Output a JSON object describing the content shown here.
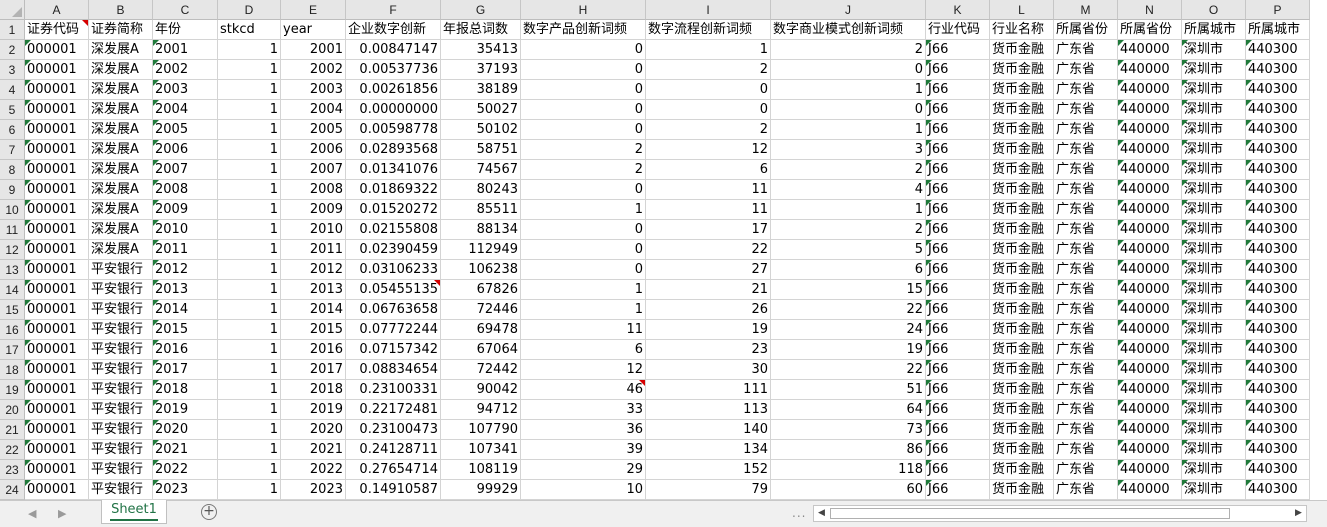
{
  "sheet_tabs": [
    "Sheet1"
  ],
  "add_sheet_symbol": "+",
  "nav": {
    "prev": "◀",
    "next": "▶",
    "more": "..."
  },
  "columns": [
    "A",
    "B",
    "C",
    "D",
    "E",
    "F",
    "G",
    "H",
    "I",
    "J",
    "K",
    "L",
    "M",
    "N",
    "O",
    "P"
  ],
  "headers": [
    "证券代码",
    "证券简称",
    "年份",
    "stkcd",
    "year",
    "企业数字创新",
    "年报总词数",
    "数字产品创新词频",
    "数字流程创新词频",
    "数字商业模式创新词频",
    "行业代码",
    "行业名称",
    "所属省份",
    "所属省份",
    "所属城市",
    "所属城市"
  ],
  "rows": [
    [
      "000001",
      "深发展A",
      "2001",
      "1",
      "2001",
      "0.00847147",
      "35413",
      "0",
      "1",
      "2",
      "J66",
      "货币金融",
      "广东省",
      "440000",
      "深圳市",
      "440300"
    ],
    [
      "000001",
      "深发展A",
      "2002",
      "1",
      "2002",
      "0.00537736",
      "37193",
      "0",
      "2",
      "0",
      "J66",
      "货币金融",
      "广东省",
      "440000",
      "深圳市",
      "440300"
    ],
    [
      "000001",
      "深发展A",
      "2003",
      "1",
      "2003",
      "0.00261856",
      "38189",
      "0",
      "0",
      "1",
      "J66",
      "货币金融",
      "广东省",
      "440000",
      "深圳市",
      "440300"
    ],
    [
      "000001",
      "深发展A",
      "2004",
      "1",
      "2004",
      "0.00000000",
      "50027",
      "0",
      "0",
      "0",
      "J66",
      "货币金融",
      "广东省",
      "440000",
      "深圳市",
      "440300"
    ],
    [
      "000001",
      "深发展A",
      "2005",
      "1",
      "2005",
      "0.00598778",
      "50102",
      "0",
      "2",
      "1",
      "J66",
      "货币金融",
      "广东省",
      "440000",
      "深圳市",
      "440300"
    ],
    [
      "000001",
      "深发展A",
      "2006",
      "1",
      "2006",
      "0.02893568",
      "58751",
      "2",
      "12",
      "3",
      "J66",
      "货币金融",
      "广东省",
      "440000",
      "深圳市",
      "440300"
    ],
    [
      "000001",
      "深发展A",
      "2007",
      "1",
      "2007",
      "0.01341076",
      "74567",
      "2",
      "6",
      "2",
      "J66",
      "货币金融",
      "广东省",
      "440000",
      "深圳市",
      "440300"
    ],
    [
      "000001",
      "深发展A",
      "2008",
      "1",
      "2008",
      "0.01869322",
      "80243",
      "0",
      "11",
      "4",
      "J66",
      "货币金融",
      "广东省",
      "440000",
      "深圳市",
      "440300"
    ],
    [
      "000001",
      "深发展A",
      "2009",
      "1",
      "2009",
      "0.01520272",
      "85511",
      "1",
      "11",
      "1",
      "J66",
      "货币金融",
      "广东省",
      "440000",
      "深圳市",
      "440300"
    ],
    [
      "000001",
      "深发展A",
      "2010",
      "1",
      "2010",
      "0.02155808",
      "88134",
      "0",
      "17",
      "2",
      "J66",
      "货币金融",
      "广东省",
      "440000",
      "深圳市",
      "440300"
    ],
    [
      "000001",
      "深发展A",
      "2011",
      "1",
      "2011",
      "0.02390459",
      "112949",
      "0",
      "22",
      "5",
      "J66",
      "货币金融",
      "广东省",
      "440000",
      "深圳市",
      "440300"
    ],
    [
      "000001",
      "平安银行",
      "2012",
      "1",
      "2012",
      "0.03106233",
      "106238",
      "0",
      "27",
      "6",
      "J66",
      "货币金融",
      "广东省",
      "440000",
      "深圳市",
      "440300"
    ],
    [
      "000001",
      "平安银行",
      "2013",
      "1",
      "2013",
      "0.05455135",
      "67826",
      "1",
      "21",
      "15",
      "J66",
      "货币金融",
      "广东省",
      "440000",
      "深圳市",
      "440300"
    ],
    [
      "000001",
      "平安银行",
      "2014",
      "1",
      "2014",
      "0.06763658",
      "72446",
      "1",
      "26",
      "22",
      "J66",
      "货币金融",
      "广东省",
      "440000",
      "深圳市",
      "440300"
    ],
    [
      "000001",
      "平安银行",
      "2015",
      "1",
      "2015",
      "0.07772244",
      "69478",
      "11",
      "19",
      "24",
      "J66",
      "货币金融",
      "广东省",
      "440000",
      "深圳市",
      "440300"
    ],
    [
      "000001",
      "平安银行",
      "2016",
      "1",
      "2016",
      "0.07157342",
      "67064",
      "6",
      "23",
      "19",
      "J66",
      "货币金融",
      "广东省",
      "440000",
      "深圳市",
      "440300"
    ],
    [
      "000001",
      "平安银行",
      "2017",
      "1",
      "2017",
      "0.08834654",
      "72442",
      "12",
      "30",
      "22",
      "J66",
      "货币金融",
      "广东省",
      "440000",
      "深圳市",
      "440300"
    ],
    [
      "000001",
      "平安银行",
      "2018",
      "1",
      "2018",
      "0.23100331",
      "90042",
      "46",
      "111",
      "51",
      "J66",
      "货币金融",
      "广东省",
      "440000",
      "深圳市",
      "440300"
    ],
    [
      "000001",
      "平安银行",
      "2019",
      "1",
      "2019",
      "0.22172481",
      "94712",
      "33",
      "113",
      "64",
      "J66",
      "货币金融",
      "广东省",
      "440000",
      "深圳市",
      "440300"
    ],
    [
      "000001",
      "平安银行",
      "2020",
      "1",
      "2020",
      "0.23100473",
      "107790",
      "36",
      "140",
      "73",
      "J66",
      "货币金融",
      "广东省",
      "440000",
      "深圳市",
      "440300"
    ],
    [
      "000001",
      "平安银行",
      "2021",
      "1",
      "2021",
      "0.24128711",
      "107341",
      "39",
      "134",
      "86",
      "J66",
      "货币金融",
      "广东省",
      "440000",
      "深圳市",
      "440300"
    ],
    [
      "000001",
      "平安银行",
      "2022",
      "1",
      "2022",
      "0.27654714",
      "108119",
      "29",
      "152",
      "118",
      "J66",
      "货币金融",
      "广东省",
      "440000",
      "深圳市",
      "440300"
    ],
    [
      "000001",
      "平安银行",
      "2023",
      "1",
      "2023",
      "0.14910587",
      "99929",
      "10",
      "79",
      "60",
      "J66",
      "货币金融",
      "广东省",
      "440000",
      "深圳市",
      "440300"
    ]
  ]
}
